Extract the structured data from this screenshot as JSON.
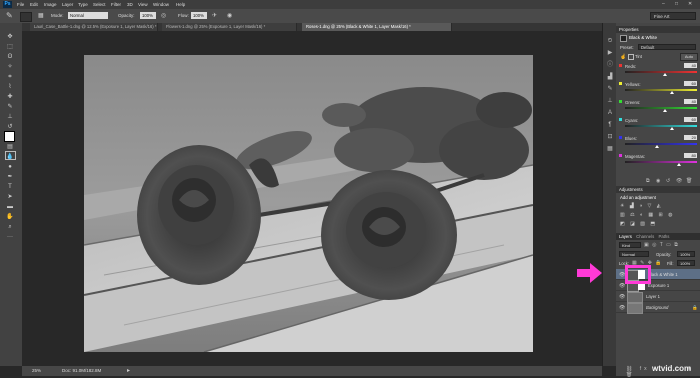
{
  "app": {
    "logo": "Ps"
  },
  "menu": [
    "File",
    "Edit",
    "Image",
    "Layer",
    "Type",
    "Select",
    "Filter",
    "3D",
    "View",
    "Window",
    "Help"
  ],
  "window_controls": [
    "–",
    "□",
    "✕"
  ],
  "options": {
    "mode_label": "Mode:",
    "mode_value": "Normal",
    "opacity_label": "Opacity:",
    "opacity_value": "100%",
    "flow_label": "Flow:",
    "flow_value": "100%",
    "workspace": "Fine Art"
  },
  "tabs": [
    "Lauri_Case_Battle-1.dng @ 12.5% (Exposure 1, Layer Mask/16) *",
    "Flowers-1.dng @ 25% (Exposure 1, Layer Mask/16) *",
    "Roses-1.dng @ 25% (Black & White 1, Layer Mask/16) *"
  ],
  "status": {
    "zoom": "25%",
    "doc": "Doc: 91.0M/182.8M"
  },
  "properties": {
    "title": "Properties",
    "adjustment": "Black & White",
    "preset_label": "Preset:",
    "preset_value": "Default",
    "tint_label": "Tint",
    "auto_label": "Auto",
    "sliders": [
      {
        "label": "Reds:",
        "value": 40,
        "level": 0.55,
        "gradient": "linear-gradient(90deg,#222,#e33)"
      },
      {
        "label": "Yellows:",
        "value": 60,
        "level": 0.65,
        "gradient": "linear-gradient(90deg,#222,#ee3)"
      },
      {
        "label": "Greens:",
        "value": 40,
        "level": 0.55,
        "gradient": "linear-gradient(90deg,#222,#3d3)"
      },
      {
        "label": "Cyans:",
        "value": 60,
        "level": 0.65,
        "gradient": "linear-gradient(90deg,#222,#3dd)"
      },
      {
        "label": "Blues:",
        "value": 20,
        "level": 0.45,
        "gradient": "linear-gradient(90deg,#222,#33e)"
      },
      {
        "label": "Magentas:",
        "value": 80,
        "level": 0.75,
        "gradient": "linear-gradient(90deg,#222,#d3d)"
      }
    ]
  },
  "adjustments": {
    "title": "Adjustments",
    "subtitle": "Add an adjustment"
  },
  "layers": {
    "tabs": [
      "Layers",
      "Channels",
      "Paths"
    ],
    "kind_label": "Kind",
    "blend_mode": "Normal",
    "opacity_label": "Opacity:",
    "opacity_value": "100%",
    "lock_label": "Lock:",
    "fill_label": "Fill:",
    "fill_value": "100%",
    "items": [
      {
        "name": "Black & White 1",
        "selected": true
      },
      {
        "name": "Exposure 1",
        "selected": false
      },
      {
        "name": "Layer 1",
        "selected": false
      },
      {
        "name": "Background",
        "selected": false
      }
    ]
  },
  "watermark": "wtvid.com",
  "colors": {
    "highlight_arrow": "#ff3ad7",
    "panel_bg": "#464646",
    "menubar_bg": "#3d3d3d"
  }
}
